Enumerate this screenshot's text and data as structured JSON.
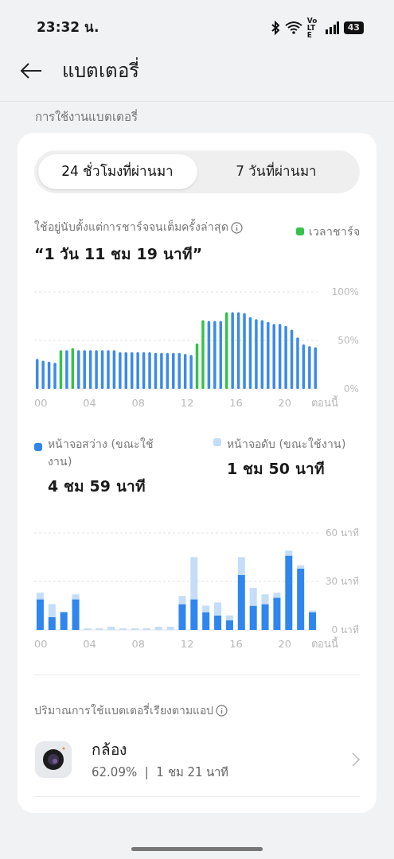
{
  "status_bar": {
    "time": "23:32 น.",
    "network": "Vo LTE",
    "battery": "43"
  },
  "header": {
    "title": "แบตเตอรี่"
  },
  "section_label": "การใช้งานแบตเตอรี่",
  "tabs": [
    {
      "label": "24 ชั่วโมงที่ผ่านมา",
      "selected": true
    },
    {
      "label": "7 วันที่ผ่านมา",
      "selected": false
    }
  ],
  "since_full_charge": {
    "label": "ใช้อยู่นับตั้งแต่การชาร์จจนเต็มครั้งล่าสุด",
    "value": "“1 วัน 11 ชม 19 นาที”"
  },
  "level_chart": {
    "chart_data": {
      "type": "bar",
      "stacked": true,
      "ylim": [
        0,
        100
      ],
      "yticks": [
        {
          "value": 0,
          "label": "0%"
        },
        {
          "value": 50,
          "label": "50%"
        },
        {
          "value": 100,
          "label": "100%"
        }
      ],
      "series": [
        {
          "color": "#3d8ae8",
          "values": [
            31,
            29,
            28,
            27,
            null,
            40,
            null,
            40,
            40,
            40,
            40,
            40,
            40,
            40,
            38,
            38,
            38,
            38,
            38,
            38,
            37,
            37,
            37,
            37,
            37,
            36,
            35,
            null,
            null,
            70,
            70,
            70,
            null,
            79,
            79,
            78,
            74,
            72,
            71,
            69,
            67,
            67,
            65,
            61,
            53,
            46,
            44,
            43
          ]
        },
        {
          "name": "เวลาชาร์จ",
          "color": "#35c24a",
          "values": [
            null,
            null,
            null,
            null,
            40,
            null,
            42,
            null,
            null,
            null,
            null,
            null,
            null,
            null,
            null,
            null,
            null,
            null,
            null,
            null,
            null,
            null,
            null,
            null,
            null,
            null,
            null,
            47,
            71,
            null,
            null,
            null,
            79,
            null,
            null,
            null,
            null,
            null,
            null,
            null,
            null,
            null,
            null,
            null,
            null,
            null,
            null,
            null
          ]
        }
      ]
    }
  },
  "screen_totals": [
    "4 ชม 59 นาที",
    "1 ชม 50 นาที"
  ],
  "screen_chart": {
    "chart_data": {
      "type": "bar",
      "stacked": true,
      "ylim": [
        0,
        60
      ],
      "yticks": [
        {
          "value": 0,
          "label": "0 นาที"
        },
        {
          "value": 30,
          "label": "30 นาที"
        },
        {
          "value": 60,
          "label": "60 นาที"
        }
      ],
      "series": [
        {
          "name": "หน้าจอสว่าง (ขณะใช้งาน)",
          "color": "#2f86ee",
          "values": [
            19,
            8,
            11,
            19,
            0,
            0,
            0,
            0,
            0,
            0,
            0,
            0,
            16,
            19,
            11,
            9,
            6,
            34,
            15,
            16,
            20,
            46,
            38,
            11
          ]
        },
        {
          "name": "หน้าจอดับ (ขณะใช้งาน)",
          "color": "#c4ddf8",
          "values": [
            4,
            8,
            0,
            3,
            1,
            1,
            2,
            1,
            1,
            1,
            2,
            2,
            5,
            26,
            4,
            8,
            3,
            11,
            11,
            6,
            3,
            3,
            2,
            1
          ]
        }
      ]
    }
  },
  "level_x_labels": [
    "00",
    "04",
    "08",
    "12",
    "16",
    "20",
    "ตอนนี้"
  ],
  "screen_x_labels": [
    "00",
    "04",
    "08",
    "12",
    "16",
    "20",
    "ตอนนี้"
  ],
  "apps": {
    "title": "ปริมาณการใช้แบตเตอรี่เรียงตามแอป",
    "items": [
      {
        "name": "กล้อง",
        "detail": "62.09%  |  1 ชม 21 นาที"
      }
    ]
  }
}
